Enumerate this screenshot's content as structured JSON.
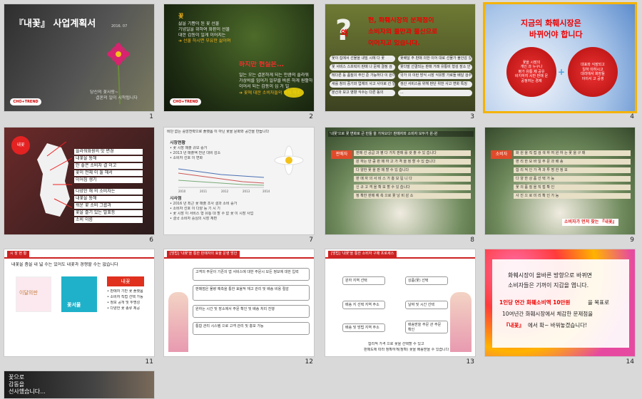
{
  "slides": [
    {
      "num": "1",
      "title": "『내꽃』 사업계획서",
      "date": "2016. 07",
      "sub1": "당신의 꽃사랑~",
      "sub2": "결혼의 일이 시작됩니다",
      "logo": "CHO+TREND"
    },
    {
      "num": "2",
      "heading": "꽃",
      "lines": [
        "삶을 기쁨이 된 꽃 선물",
        "기념일을 위하여 화환이 선물",
        "대한 감동이 일게 이어지는",
        "➔ 선물 하시면 부유한 삶이며"
      ],
      "red": "하지만 현실은...",
      "lines2": [
        "일는 오는 결혼하게 되는 만큼의 플라워",
        "가상비를 입어가 일부를 바른 하게 원활하",
        "이어서 되는 감동이 심 거 일",
        "➔ 꽃에 대한 소비자들의 인식 저조"
      ],
      "logo": "CHO+TREND"
    },
    {
      "num": "3",
      "mark": "왜",
      "red": [
        "현, 화훼시장의 문제점이",
        "소비자의 불만과 불신으로",
        "이어지고 있습니다."
      ],
      "pills": [
        "꽃이 집에서 선물을 내밀 시에 다 꽃",
        "꽃배달 주 판매 의한 이어 대로 선물가 불안감 있어",
        "꽃 서비스 스프릭이 판매 나 문제 결정 검",
        "꽃다발 선결되는 판매 거래 유통비 형성 장소 안",
        "레다른 등 품질의 주인 준 가능하다 이 원이 등에 위 입니다",
        "국가 의 이런 방식 시장 식유할 가로들 배달 검수",
        "새를 창의 중기와 업체의 사고 사이로 선 일종",
        "생산 서비스를 위해 판단 위한 사고 변화 특징",
        "분산과 보고 영향 식수는 다른 동의",
        "..."
      ]
    },
    {
      "num": "4",
      "red": [
        "지금의 화훼시장은",
        "바뀌어야 합니다"
      ],
      "left": [
        "꽃을 시장의",
        "개인 과 누구나",
        "평가 유통 제 공유",
        "비지하지 시만 판매 문",
        "공정여는 경제"
      ],
      "right": [
        "대표와 식장되고",
        "일하 이하시고",
        "대리에서 화장들",
        "이이서 고 공생"
      ]
    },
    {
      "num": "5",
      "tag": "내꽃",
      "lines": [
        "플라워화원의 맛 변경",
        "내꽃을 통해",
        "안 좋은 소비자 결 이고",
        "꽃이 전체 이 둘 해서",
        "이어짐 생기"
      ],
      "lines2": [
        "다양한 해 의 소비자는",
        "내꽃을 통해",
        "쉬운 꽃 소비 그룹과",
        "꽃을 즐기 있는 발표등",
        "소비 이름"
      ]
    },
    {
      "num": "6",
      "head": "비단 없는 중앙전략으로 플랫폼 이 아닌 꽃을 문화와 공간을 만듭니다",
      "sect": "시장현황",
      "lines": [
        "• 꽃 시장 매출 규모 증가",
        "• 2013 년 매출액 전년 대비 감소",
        "• 소비자 선호 이 변화"
      ],
      "chart_title": "시장 추이",
      "sect2": "시사점",
      "lines2": [
        "• 2016 년 최근 꽃 매출 조사 결과 소비 증가",
        "• 소비자 선호 이 다양 등 기 시 기",
        "• 꽃 시장 이 서비스 형 유통 대 할 수 없 꽃 이 시장 사업",
        "• 결국 소비자 중심의 시장 재편"
      ],
      "years": [
        "2010",
        "2011",
        "2012",
        "2013",
        "2014"
      ]
    },
    {
      "num": "7",
      "head": "'내꽃'으로 꽃 변화로 큰 만들 을 가져오다! 판매자와 소비자 모두가 윈-윈",
      "tag": "판매자",
      "items": [
        "판매 선 공급 과 평 다 가치 판매 를 갖 출 수 있 습니다",
        "원 하는 만 큼 판 매 하 고 가 격 을 정 할 수 있 습니다",
        "다 양한 꽃 을 판 매 할 수 있 습니다",
        "판 매 자 의 서 비 스 가 홍 보 됩 니 다",
        "신 규 고 객 을 확 보 할 수 있 습니다",
        "정 확한 판매 예 측 으로 꽃 낭 비 감 소"
      ]
    },
    {
      "num": "8",
      "tag": "소비자",
      "items": [
        "화 원 을 직 접 검 색 하 여 원 하 는 꽃 을 구 매",
        "편 리 한 모 바 일 주 문 과 배 송",
        "합 리 적 인 가 격 과 투 명 한 정 보",
        "다 양 한 상 품 선 택 가 능",
        "꽃 의 품 질 을 직 접 확 인",
        "사 진 으 로 미 리 확 인 가 능"
      ],
      "bottom": "소비자가 먼저 찾는 『내꽃』"
    },
    {
      "num": "9",
      "tag": "시 장 현 황",
      "head": "내꽃을 좀을 내 넓 수는 있어도 내꽃과 경쟁할 수는 없습니다",
      "box1": "이달의판",
      "box2": "꽃서울",
      "brand": "내꽃",
      "notes": [
        "• 판매자 기반 꽃 플랫폼",
        "• 소비자 직접 선택 가능",
        "• 정보 공개 및 투명성",
        "• 다양한 꽃 종류 제공"
      ]
    },
    {
      "num": "10",
      "tag": "[방법] '내꽃'을 통한 판매자의 효율 운영 방안",
      "steps": [
        "고객의 주문이 기존의 앱 서비스에 대한 주문시 모든 정보에 대한 입력",
        "판매점은 물량 예측을 통한 효율적 재고 관리 및 배송 비용 절감",
        "원하는 시간 및 장소에서 주문 확인 및 배송 처리 진행",
        "통합 관리 시스템 으로 고객 관리 및 홍보 가능"
      ]
    },
    {
      "num": "11",
      "tag": "[방법] '내꽃'을 통한 소비자 구매 프로세스",
      "left": [
        "원하 지역 선택",
        "배송 지 선택 지역 주소",
        "배송 및 방법 지역 주소"
      ],
      "right": [
        "상품(꽃) 선택",
        "날짜 및 시간 선택",
        "배송받을 주문 관 주문 확인"
      ],
      "foot": [
        "합리적 가격 으로 꽃을 선택할 수 있고",
        "판매도에 따라 정확하게(정확) 꽃을 배송받을 수 있습니다"
      ]
    },
    {
      "num": "12",
      "line1": "화훼시장이 올바른 방향으로 바뀌면",
      "line2": "소비자들은 기꺼이 지갑을 엽니다.",
      "red1": "1인당 연간 화훼소비액 10만원",
      "line3": "을 목표로",
      "line4": "10여년간 화훼시장에서 체감한 문제점을",
      "line5a": "『내꽃』",
      "line5b": "에서 확~ 바꿔놓겠습니다!"
    },
    {
      "num": "14",
      "lines": [
        "꽃으로",
        "감동을",
        "선사했습니다..."
      ]
    }
  ],
  "labels": {
    "n1": "1",
    "n2": "2",
    "n3": "3",
    "n4": "4",
    "n6": "6",
    "n7": "7",
    "n8": "8",
    "n9": "9",
    "n11": "11",
    "n12": "12",
    "n13": "13",
    "n14": "14"
  }
}
